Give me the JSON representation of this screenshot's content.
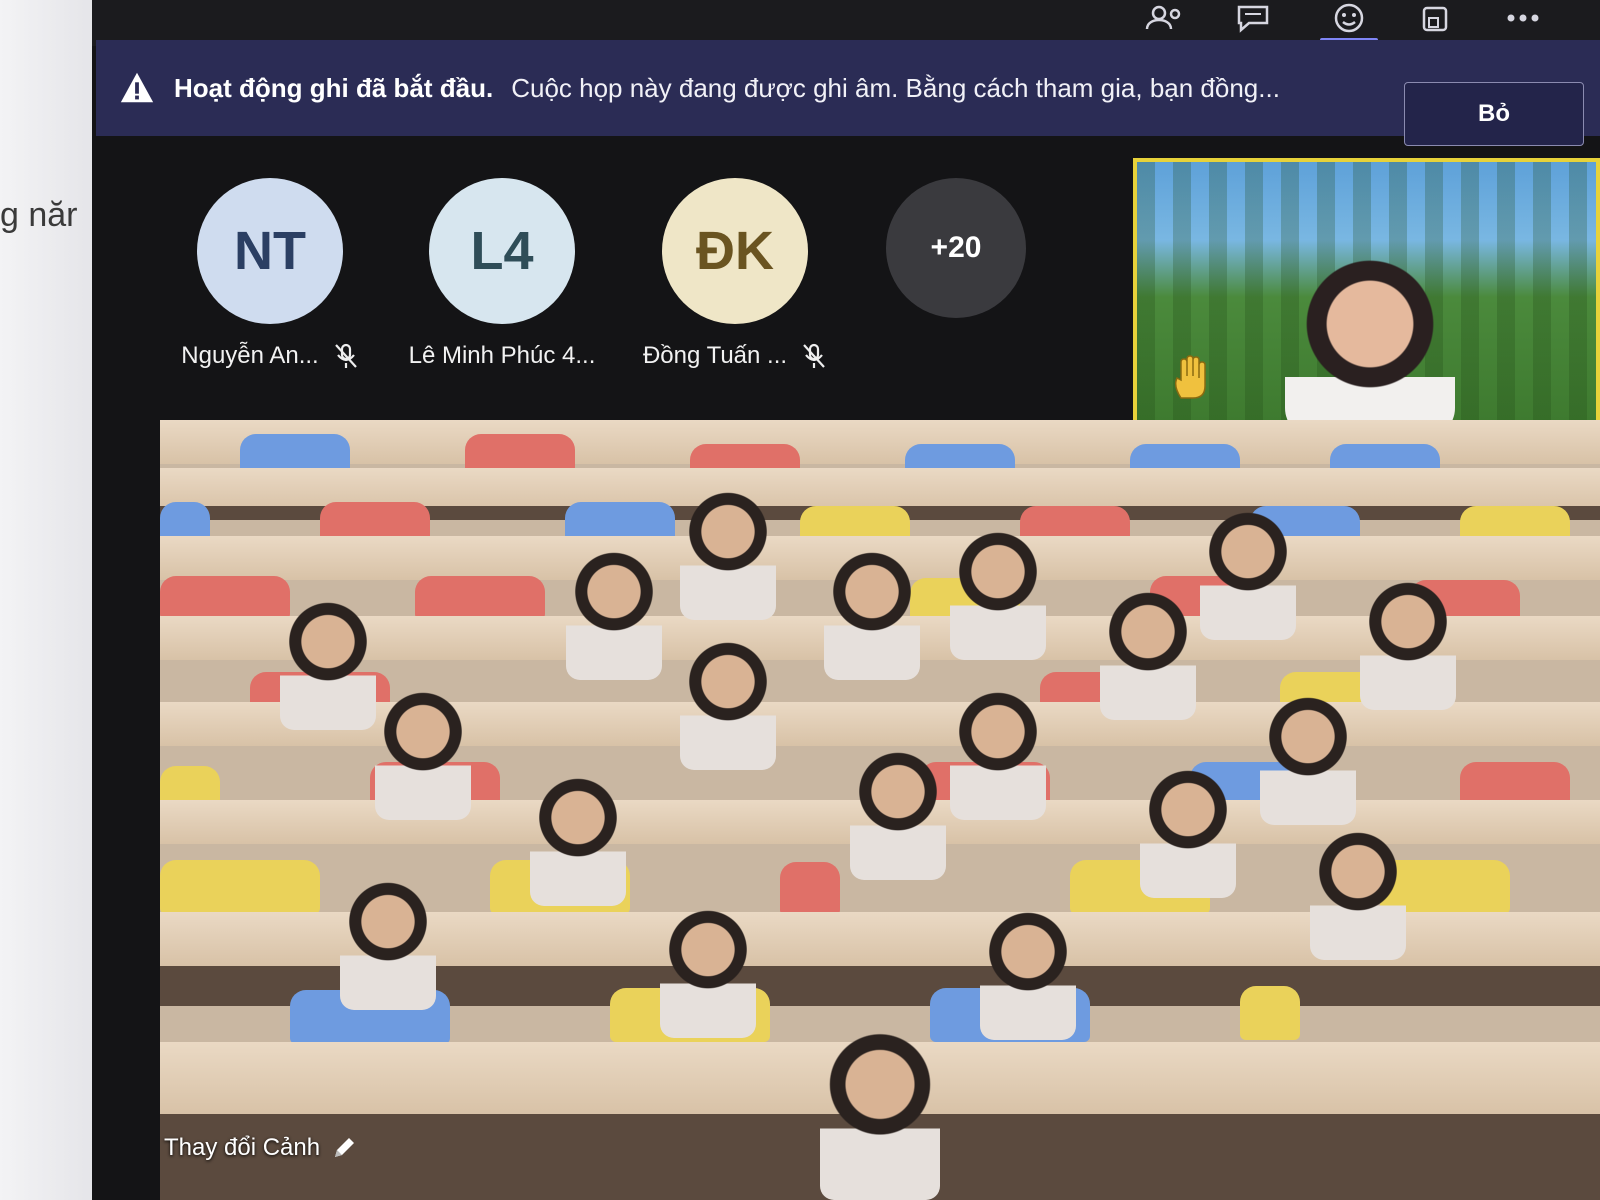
{
  "background_doc": {
    "text": "g năr"
  },
  "toolbar": {
    "icons": [
      "people-icon",
      "chat-icon",
      "reactions-icon",
      "share-icon",
      "more-icon"
    ],
    "active_index": 2,
    "accent": "#7f85f5"
  },
  "recording_banner": {
    "title": "Hoạt động ghi đã bắt đầu.",
    "message": "Cuộc họp này đang được ghi âm. Bằng cách tham gia, bạn đồng...",
    "dismiss_label": "Bỏ",
    "background": "#2b2c55"
  },
  "participants": [
    {
      "initials": "NT",
      "name": "Nguyễn An...",
      "muted": true,
      "avatar_color": "#cfdcef",
      "text_color": "#2b3f63"
    },
    {
      "initials": "L4",
      "name": "Lê Minh Phúc 4...",
      "muted": false,
      "avatar_color": "#d7e6ef",
      "text_color": "#2f4d58"
    },
    {
      "initials": "ĐK",
      "name": "Đồng Tuấn ...",
      "muted": true,
      "avatar_color": "#efe6c7",
      "text_color": "#6a5421"
    },
    {
      "initials": "+20",
      "name": "",
      "muted": false,
      "avatar_color": "#3a3a3e",
      "text_color": "#ffffff"
    }
  ],
  "self_view": {
    "hand_raised": true,
    "highlight_color": "#e7d23a"
  },
  "together_mode": {
    "scene_label": "Thay đổi Cảnh"
  }
}
